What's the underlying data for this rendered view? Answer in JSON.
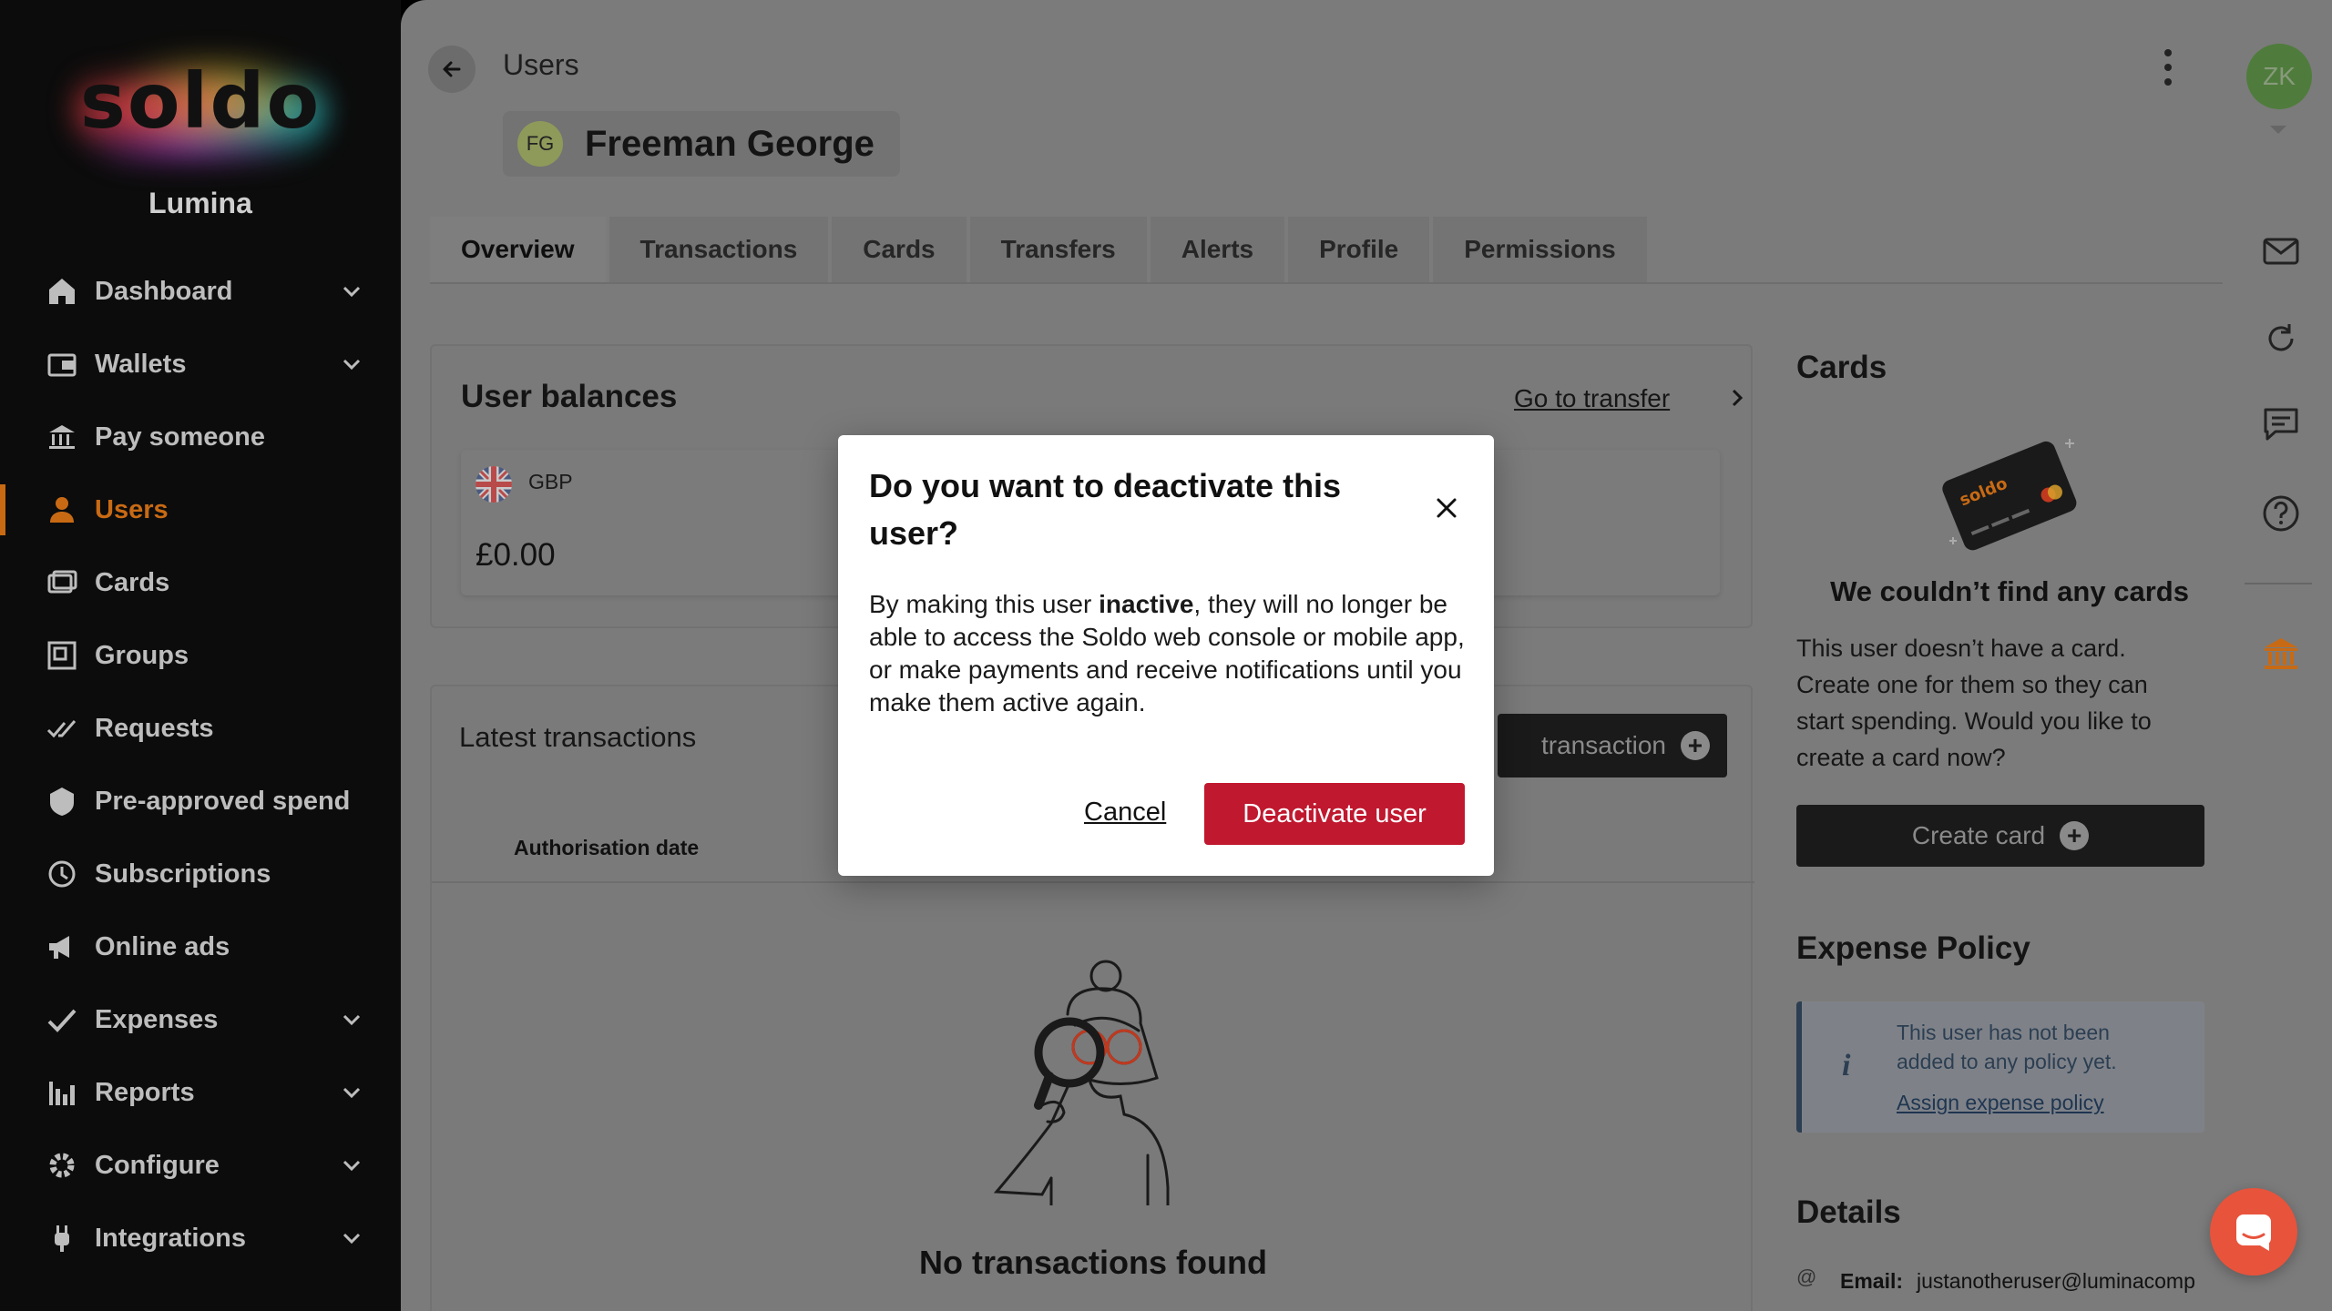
{
  "brand": {
    "logo": "soldo",
    "org": "Lumina"
  },
  "sidebar": {
    "items": [
      {
        "label": "Dashboard",
        "icon": "home-icon",
        "expandable": true
      },
      {
        "label": "Wallets",
        "icon": "wallet-icon",
        "expandable": true
      },
      {
        "label": "Pay someone",
        "icon": "bank-pay-icon",
        "expandable": false
      },
      {
        "label": "Users",
        "icon": "user-icon",
        "expandable": false,
        "active": true
      },
      {
        "label": "Cards",
        "icon": "cards-icon",
        "expandable": false
      },
      {
        "label": "Groups",
        "icon": "groups-icon",
        "expandable": false
      },
      {
        "label": "Requests",
        "icon": "requests-icon",
        "expandable": false
      },
      {
        "label": "Pre-approved spend",
        "icon": "shield-icon",
        "expandable": false
      },
      {
        "label": "Subscriptions",
        "icon": "clock-icon",
        "expandable": false
      },
      {
        "label": "Online ads",
        "icon": "megaphone-icon",
        "expandable": false
      },
      {
        "label": "Expenses",
        "icon": "checkmark-icon",
        "expandable": true
      },
      {
        "label": "Reports",
        "icon": "bar-chart-icon",
        "expandable": true
      },
      {
        "label": "Configure",
        "icon": "gear-icon",
        "expandable": true
      },
      {
        "label": "Integrations",
        "icon": "plug-icon",
        "expandable": true
      }
    ]
  },
  "header": {
    "breadcrumb": "Users",
    "user_initials": "FG",
    "user_name": "Freeman George"
  },
  "tabs": [
    "Overview",
    "Transactions",
    "Cards",
    "Transfers",
    "Alerts",
    "Profile",
    "Permissions"
  ],
  "balances": {
    "title": "User balances",
    "go_to_transfer": "Go to transfer",
    "currency": "GBP",
    "amount": "£0.00"
  },
  "latest": {
    "title": "Latest transactions",
    "add_button": "transaction",
    "col_auth_date": "Authorisation date",
    "empty_title": "No transactions found"
  },
  "cards_panel": {
    "title": "Cards",
    "empty_title": "We couldn’t find any cards",
    "empty_text": [
      "This user doesn’t have a card.",
      "Create one for them so they can",
      "start spending. Would you like to",
      "create a card now?"
    ],
    "create_button": "Create card",
    "card_logo": "soldo"
  },
  "expense_policy": {
    "title": "Expense Policy",
    "info_lines": [
      "This user has not been",
      "added to any policy yet."
    ],
    "link": "Assign expense policy"
  },
  "details": {
    "title": "Details",
    "email_label": "Email:",
    "email_value": "justanotheruser@luminacomp"
  },
  "util": {
    "avatar": "ZK"
  },
  "modal": {
    "title": "Do you want to deactivate this user?",
    "body_before": "By making this user ",
    "body_bold": "inactive",
    "body_after": ", they will no longer be able to access the Soldo web console or mobile app, or make payments and receive notifications until you make them active again.",
    "cancel": "Cancel",
    "confirm": "Deactivate user"
  },
  "colors": {
    "accent": "#c86a14",
    "danger": "#c0182f",
    "fab": "#e8533c"
  }
}
